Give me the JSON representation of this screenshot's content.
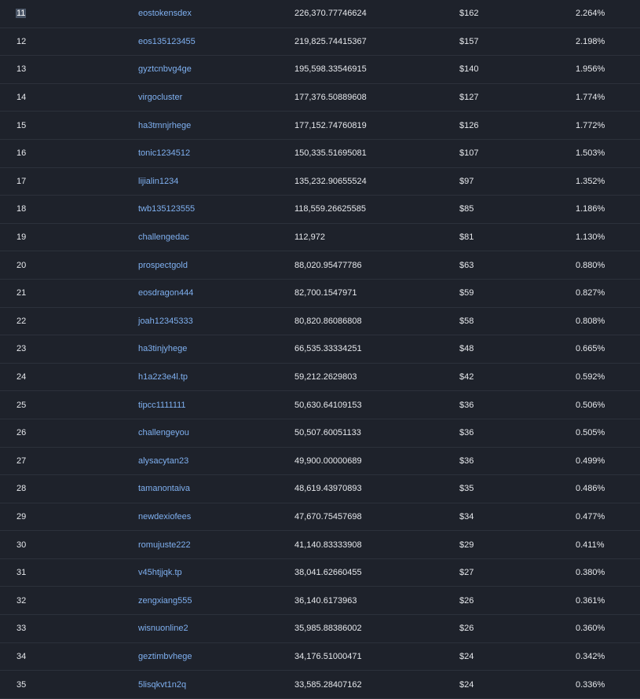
{
  "table": {
    "rows": [
      {
        "rank": "11",
        "account": "eostokensdex",
        "quantity": "226,370.77746624",
        "value": "$162",
        "percentage": "2.264%"
      },
      {
        "rank": "12",
        "account": "eos135123455",
        "quantity": "219,825.74415367",
        "value": "$157",
        "percentage": "2.198%"
      },
      {
        "rank": "13",
        "account": "gyztcnbvg4ge",
        "quantity": "195,598.33546915",
        "value": "$140",
        "percentage": "1.956%"
      },
      {
        "rank": "14",
        "account": "virgocluster",
        "quantity": "177,376.50889608",
        "value": "$127",
        "percentage": "1.774%"
      },
      {
        "rank": "15",
        "account": "ha3tmnjrhege",
        "quantity": "177,152.74760819",
        "value": "$126",
        "percentage": "1.772%"
      },
      {
        "rank": "16",
        "account": "tonic1234512",
        "quantity": "150,335.51695081",
        "value": "$107",
        "percentage": "1.503%"
      },
      {
        "rank": "17",
        "account": "lijialin1234",
        "quantity": "135,232.90655524",
        "value": "$97",
        "percentage": "1.352%"
      },
      {
        "rank": "18",
        "account": "twb135123555",
        "quantity": "118,559.26625585",
        "value": "$85",
        "percentage": "1.186%"
      },
      {
        "rank": "19",
        "account": "challengedac",
        "quantity": "112,972",
        "value": "$81",
        "percentage": "1.130%"
      },
      {
        "rank": "20",
        "account": "prospectgold",
        "quantity": "88,020.95477786",
        "value": "$63",
        "percentage": "0.880%"
      },
      {
        "rank": "21",
        "account": "eosdragon444",
        "quantity": "82,700.1547971",
        "value": "$59",
        "percentage": "0.827%"
      },
      {
        "rank": "22",
        "account": "joah12345333",
        "quantity": "80,820.86086808",
        "value": "$58",
        "percentage": "0.808%"
      },
      {
        "rank": "23",
        "account": "ha3tinjyhege",
        "quantity": "66,535.33334251",
        "value": "$48",
        "percentage": "0.665%"
      },
      {
        "rank": "24",
        "account": "h1a2z3e4l.tp",
        "quantity": "59,212.2629803",
        "value": "$42",
        "percentage": "0.592%"
      },
      {
        "rank": "25",
        "account": "tipcc1111111",
        "quantity": "50,630.64109153",
        "value": "$36",
        "percentage": "0.506%"
      },
      {
        "rank": "26",
        "account": "challengeyou",
        "quantity": "50,507.60051133",
        "value": "$36",
        "percentage": "0.505%"
      },
      {
        "rank": "27",
        "account": "alysacytan23",
        "quantity": "49,900.00000689",
        "value": "$36",
        "percentage": "0.499%"
      },
      {
        "rank": "28",
        "account": "tamanontaiva",
        "quantity": "48,619.43970893",
        "value": "$35",
        "percentage": "0.486%"
      },
      {
        "rank": "29",
        "account": "newdexiofees",
        "quantity": "47,670.75457698",
        "value": "$34",
        "percentage": "0.477%"
      },
      {
        "rank": "30",
        "account": "romujuste222",
        "quantity": "41,140.83333908",
        "value": "$29",
        "percentage": "0.411%"
      },
      {
        "rank": "31",
        "account": "v45htjjqk.tp",
        "quantity": "38,041.62660455",
        "value": "$27",
        "percentage": "0.380%"
      },
      {
        "rank": "32",
        "account": "zengxiang555",
        "quantity": "36,140.6173963",
        "value": "$26",
        "percentage": "0.361%"
      },
      {
        "rank": "33",
        "account": "wisnuonline2",
        "quantity": "35,985.88386002",
        "value": "$26",
        "percentage": "0.360%"
      },
      {
        "rank": "34",
        "account": "geztimbvhege",
        "quantity": "34,176.51000471",
        "value": "$24",
        "percentage": "0.342%"
      },
      {
        "rank": "35",
        "account": "5lisqkvt1n2q",
        "quantity": "33,585.28407162",
        "value": "$24",
        "percentage": "0.336%"
      }
    ],
    "selected_rank": "11"
  },
  "colors": {
    "background": "#1e222b",
    "link": "#7fb0f0",
    "text": "#e6e8ec",
    "row_divider": "#2c313b",
    "selection": "#4a5566"
  }
}
